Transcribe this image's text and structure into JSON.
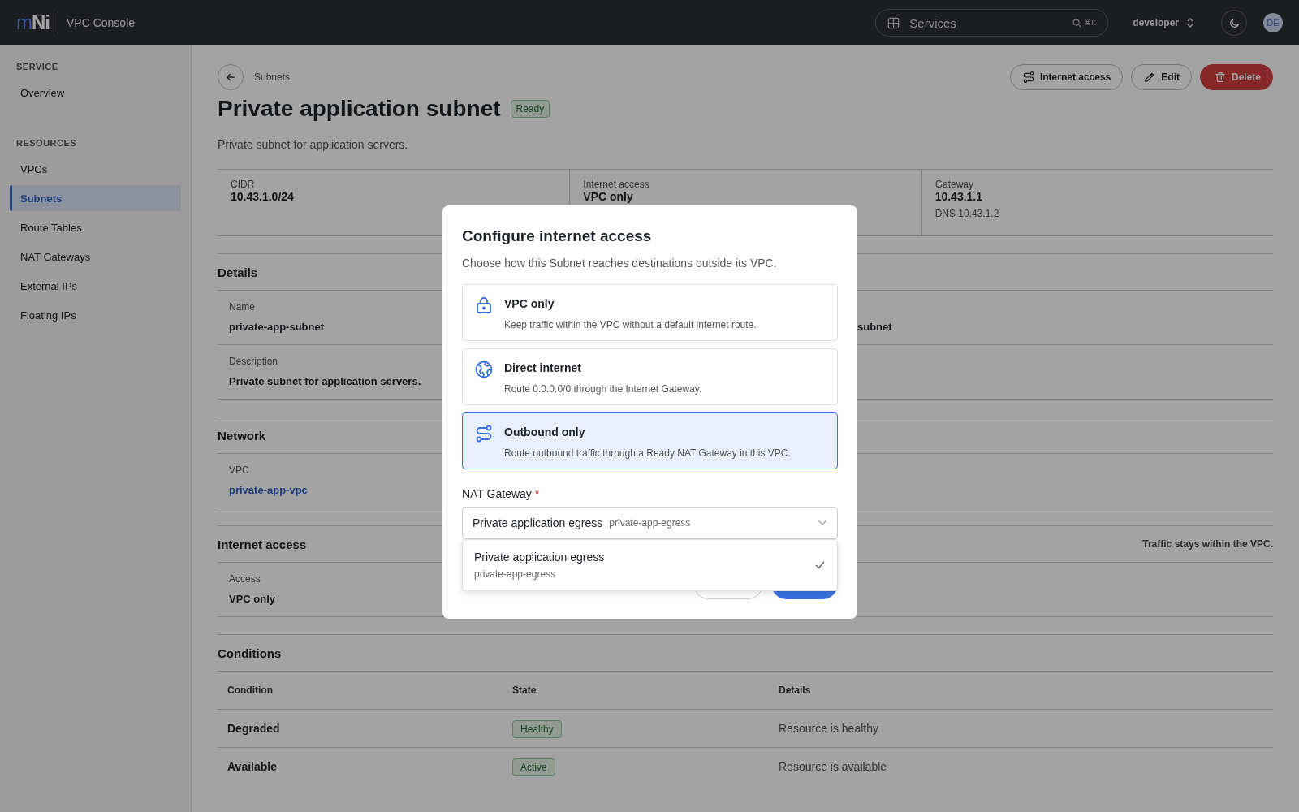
{
  "topbar": {
    "logo": "mNi",
    "app_title": "VPC Console",
    "search": {
      "placeholder": "Services",
      "shortcut": "⌘K"
    },
    "project": "developer",
    "avatar": "DE"
  },
  "sidebar": {
    "sections": [
      {
        "heading": "SERVICE",
        "items": [
          {
            "label": "Overview",
            "selected": false
          }
        ]
      },
      {
        "heading": "RESOURCES",
        "items": [
          {
            "label": "VPCs",
            "selected": false
          },
          {
            "label": "Subnets",
            "selected": true
          },
          {
            "label": "Route Tables",
            "selected": false
          },
          {
            "label": "NAT Gateways",
            "selected": false
          },
          {
            "label": "External IPs",
            "selected": false
          },
          {
            "label": "Floating IPs",
            "selected": false
          }
        ]
      }
    ]
  },
  "page": {
    "breadcrumb": "Subnets",
    "title": "Private application subnet",
    "status": "Ready",
    "description": "Private subnet for application servers.",
    "actions": [
      {
        "label": "Internet access",
        "kind": "access"
      },
      {
        "label": "Edit",
        "kind": "edit"
      },
      {
        "label": "Delete",
        "kind": "delete"
      }
    ],
    "summary": [
      {
        "label": "CIDR",
        "value": "10.43.1.0/24"
      },
      {
        "label": "Internet access",
        "value": "VPC only"
      },
      {
        "label": "Gateway",
        "value": "10.43.1.1",
        "note": "DNS 10.43.1.2"
      }
    ],
    "sections": [
      {
        "title": "Details",
        "rows": [
          [
            {
              "label": "Name",
              "value": "private-app-subnet"
            },
            {
              "value": "subnet"
            }
          ],
          [
            {
              "label": "Description",
              "value": "Private subnet for application servers."
            }
          ]
        ]
      },
      {
        "title": "Network",
        "rows": [
          [
            {
              "label": "VPC",
              "value": "private-app-vpc",
              "kind": "link"
            }
          ]
        ]
      },
      {
        "title": "Internet access",
        "aside": "Traffic stays within the VPC.",
        "rows": [
          [
            {
              "label": "Access",
              "value": "VPC only"
            }
          ]
        ]
      }
    ],
    "conditions": {
      "title": "Conditions",
      "columns": [
        "Condition",
        "State",
        "Details"
      ],
      "rows": [
        {
          "condition": "Degraded",
          "state": "Healthy",
          "details": "Resource is healthy"
        },
        {
          "condition": "Available",
          "state": "Active",
          "details": "Resource is available"
        }
      ]
    }
  },
  "dialog": {
    "title": "Configure internet access",
    "description": "Choose how this Subnet reaches destinations outside its VPC.",
    "options": [
      {
        "title": "VPC only",
        "description": "Keep traffic within the VPC without a default internet route.",
        "kind": "private",
        "selected": false
      },
      {
        "title": "Direct internet",
        "description": "Route 0.0.0.0/0 through the Internet Gateway.",
        "kind": "direct",
        "selected": false
      },
      {
        "title": "Outbound only",
        "description": "Route outbound traffic through a Ready NAT Gateway in this VPC.",
        "kind": "outbound",
        "selected": true
      }
    ],
    "field": {
      "label": "NAT Gateway",
      "required_mark": "*",
      "value": "Private application egress",
      "value_detail": "private-app-egress",
      "dropdown": [
        {
          "label": "Private application egress",
          "detail": "private-app-egress",
          "selected": true
        }
      ]
    }
  }
}
